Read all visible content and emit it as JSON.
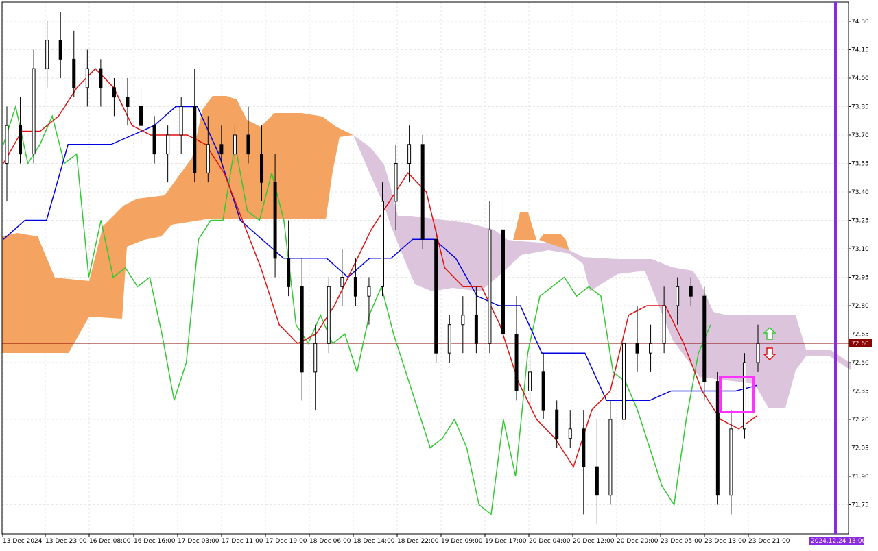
{
  "chart_data": {
    "type": "candlestick",
    "price_scale": {
      "ticks": [
        "74.30",
        "74.15",
        "74.00",
        "73.85",
        "73.70",
        "73.55",
        "73.40",
        "73.25",
        "73.10",
        "72.95",
        "72.80",
        "72.65",
        "72.50",
        "72.35",
        "72.20",
        "72.05",
        "71.90",
        "71.75"
      ],
      "current_price_label": "72.60",
      "ylim": [
        71.6,
        74.4
      ]
    },
    "time_axis": {
      "labels": [
        "13 Dec 2024",
        "13 Dec 23:00",
        "16 Dec 08:00",
        "16 Dec 16:00",
        "17 Dec 03:00",
        "17 Dec 11:00",
        "17 Dec 19:00",
        "18 Dec 06:00",
        "18 Dec 14:00",
        "18 Dec 22:00",
        "19 Dec 09:00",
        "19 Dec 17:00",
        "20 Dec 04:00",
        "20 Dec 12:00",
        "20 Dec 20:00",
        "23 Dec 05:00",
        "23 Dec 13:00",
        "23 Dec 21:00"
      ],
      "marker_label": "2024.12.24 13:00"
    },
    "colors": {
      "tenkan": "#e01010",
      "kijun": "#0000e0",
      "chikou": "#32c832",
      "cloud_bull": "#f4a460",
      "cloud_bear": "#d8bfd8",
      "current_line": "#8b0000",
      "time_marker": "#8a2be2",
      "highlight_box": "#ff33ff",
      "arrow_up": "#32c832",
      "arrow_down": "#e01010"
    },
    "candles": [
      [
        73.55,
        73.85,
        73.35,
        73.75
      ],
      [
        73.75,
        73.9,
        73.55,
        73.6
      ],
      [
        73.6,
        74.15,
        73.55,
        74.05
      ],
      [
        74.05,
        74.3,
        73.95,
        74.2
      ],
      [
        74.2,
        74.35,
        74.0,
        74.1
      ],
      [
        74.1,
        74.25,
        73.9,
        73.95
      ],
      [
        73.95,
        74.15,
        73.85,
        74.05
      ],
      [
        74.05,
        74.1,
        73.85,
        73.95
      ],
      [
        73.95,
        74.0,
        73.8,
        73.9
      ],
      [
        73.9,
        74.0,
        73.75,
        73.85
      ],
      [
        73.85,
        73.95,
        73.65,
        73.75
      ],
      [
        73.75,
        73.8,
        73.55,
        73.6
      ],
      [
        73.6,
        73.75,
        73.45,
        73.7
      ],
      [
        73.7,
        73.9,
        73.6,
        73.85
      ],
      [
        73.85,
        74.05,
        73.45,
        73.5
      ],
      [
        73.5,
        73.8,
        73.45,
        73.65
      ],
      [
        73.65,
        73.75,
        73.55,
        73.6
      ],
      [
        73.6,
        73.75,
        73.55,
        73.7
      ],
      [
        73.7,
        73.85,
        73.55,
        73.6
      ],
      [
        73.6,
        73.75,
        73.35,
        73.45
      ],
      [
        73.45,
        73.6,
        72.95,
        73.05
      ],
      [
        73.05,
        73.25,
        72.85,
        72.9
      ],
      [
        72.9,
        73.05,
        72.3,
        72.45
      ],
      [
        72.45,
        72.7,
        72.25,
        72.6
      ],
      [
        72.6,
        72.95,
        72.55,
        72.9
      ],
      [
        72.9,
        73.1,
        72.8,
        72.95
      ],
      [
        72.95,
        73.05,
        72.8,
        72.85
      ],
      [
        72.85,
        72.95,
        72.7,
        72.9
      ],
      [
        72.9,
        73.45,
        72.85,
        73.35
      ],
      [
        73.35,
        73.65,
        73.2,
        73.55
      ],
      [
        73.55,
        73.75,
        73.45,
        73.65
      ],
      [
        73.65,
        73.7,
        73.1,
        73.15
      ],
      [
        73.15,
        73.2,
        72.5,
        72.55
      ],
      [
        72.55,
        72.75,
        72.5,
        72.7
      ],
      [
        72.7,
        72.85,
        72.55,
        72.75
      ],
      [
        72.75,
        72.9,
        72.55,
        72.6
      ],
      [
        72.6,
        73.35,
        72.55,
        73.2
      ],
      [
        73.2,
        73.4,
        72.6,
        72.65
      ],
      [
        72.65,
        72.85,
        72.3,
        72.35
      ],
      [
        72.35,
        72.55,
        72.25,
        72.45
      ],
      [
        72.45,
        72.55,
        72.2,
        72.25
      ],
      [
        72.25,
        72.3,
        72.05,
        72.1
      ],
      [
        72.1,
        72.25,
        72.05,
        72.15
      ],
      [
        72.15,
        72.25,
        71.7,
        71.95
      ],
      [
        71.95,
        72.2,
        71.65,
        71.8
      ],
      [
        71.8,
        72.3,
        71.75,
        72.2
      ],
      [
        72.2,
        72.7,
        72.15,
        72.6
      ],
      [
        72.6,
        72.8,
        72.45,
        72.55
      ],
      [
        72.55,
        72.7,
        72.45,
        72.6
      ],
      [
        72.6,
        72.9,
        72.55,
        72.8
      ],
      [
        72.8,
        72.95,
        72.7,
        72.9
      ],
      [
        72.9,
        72.95,
        72.8,
        72.85
      ],
      [
        72.85,
        72.9,
        72.3,
        72.4
      ],
      [
        72.4,
        72.45,
        71.75,
        71.8
      ],
      [
        71.8,
        72.25,
        71.7,
        72.15
      ],
      [
        72.15,
        72.55,
        72.1,
        72.5
      ],
      [
        72.5,
        72.7,
        72.45,
        72.6
      ]
    ],
    "lines": {
      "tenkan": [
        73.55,
        73.72,
        73.72,
        73.8,
        73.95,
        74.05,
        73.95,
        73.75,
        73.7,
        73.7,
        73.7,
        73.65,
        73.5,
        73.25,
        73.0,
        72.7,
        72.6,
        72.65,
        72.8,
        73.0,
        73.2,
        73.35,
        73.5,
        73.4,
        73.0,
        72.9,
        72.9,
        72.7,
        72.4,
        72.2,
        72.1,
        71.95,
        72.25,
        72.35,
        72.75,
        72.8,
        72.8,
        72.6,
        72.35,
        72.2,
        72.15,
        72.22
      ],
      "kijun": [
        73.15,
        73.25,
        73.25,
        73.65,
        73.65,
        73.65,
        73.7,
        73.75,
        73.85,
        73.85,
        73.6,
        73.25,
        73.15,
        73.05,
        73.05,
        73.05,
        72.95,
        73.05,
        73.05,
        73.15,
        73.15,
        73.05,
        72.85,
        72.8,
        72.8,
        72.55,
        72.55,
        72.55,
        72.3,
        72.3,
        72.3,
        72.35,
        72.35,
        72.35,
        72.35,
        72.38
      ],
      "chikou": [
        73.65,
        73.85,
        73.55,
        73.65,
        73.8,
        73.55,
        73.6,
        72.95,
        73.25,
        72.95,
        73.0,
        72.9,
        72.95,
        72.65,
        72.3,
        72.5,
        73.15,
        73.25,
        73.25,
        73.65,
        73.3,
        73.25,
        73.5,
        73.25,
        72.7,
        72.6,
        72.75,
        72.6,
        72.65,
        72.45,
        72.75,
        72.9,
        72.65,
        72.45,
        72.25,
        72.05,
        72.1,
        72.2,
        72.05,
        71.75,
        71.7,
        72.2,
        71.9,
        72.55,
        72.85,
        72.9,
        72.95,
        72.85,
        72.9,
        72.85,
        72.45,
        72.4,
        72.25,
        72.05,
        71.85,
        71.75,
        72.2,
        72.55,
        72.7
      ]
    }
  }
}
